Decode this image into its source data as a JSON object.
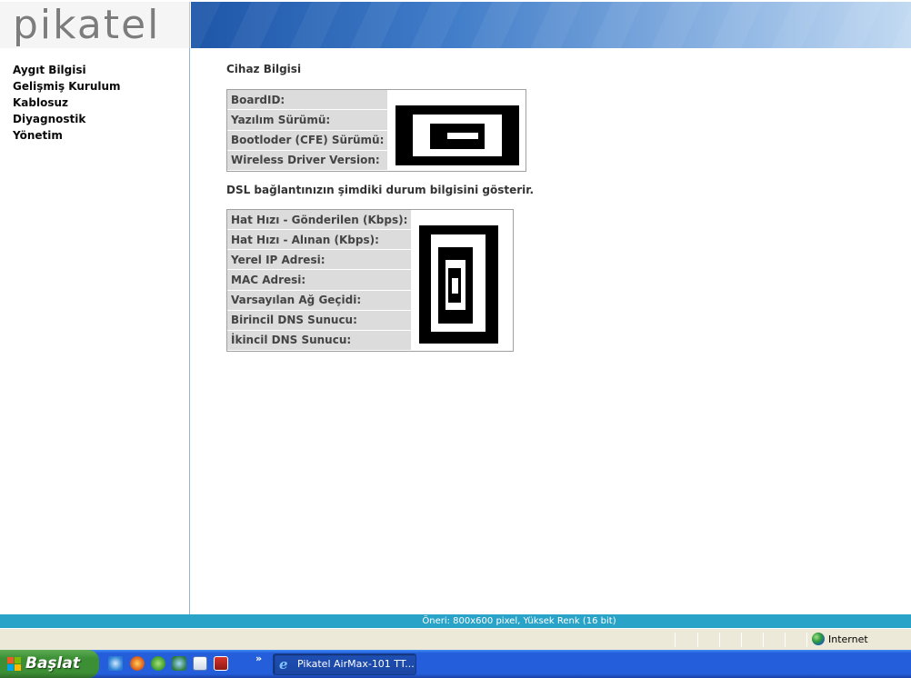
{
  "brand": {
    "logo_text": "pikatel"
  },
  "sidebar": {
    "items": [
      {
        "label": "Aygıt Bilgisi"
      },
      {
        "label": "Gelişmiş Kurulum"
      },
      {
        "label": "Kablosuz"
      },
      {
        "label": "Diyagnostik"
      },
      {
        "label": "Yönetim"
      }
    ]
  },
  "main": {
    "title": "Cihaz Bilgisi",
    "device_table": [
      {
        "label": "BoardID:"
      },
      {
        "label": "Yazılım Sürümü:"
      },
      {
        "label": "Bootloder (CFE) Sürümü:"
      },
      {
        "label": "Wireless Driver Version:"
      }
    ],
    "dsl_description": "DSL bağlantınızın şimdiki durum bilgisini gösterir.",
    "dsl_table": [
      {
        "label": "Hat Hızı - Gönderilen (Kbps):"
      },
      {
        "label": "Hat Hızı - Alınan (Kbps):"
      },
      {
        "label": "Yerel IP Adresi:"
      },
      {
        "label": "MAC Adresi:"
      },
      {
        "label": "Varsayılan Ağ Geçidi:"
      },
      {
        "label": "Birincil DNS Sunucu:"
      },
      {
        "label": "İkincil DNS Sunucu:"
      }
    ]
  },
  "hint_bar": {
    "text": "Öneri: 800x600 pixel, Yüksek Renk (16 bit)"
  },
  "ie_status": {
    "zone": "Internet"
  },
  "taskbar": {
    "start_label": "Başlat",
    "chevron": "»",
    "active_task": "Pikatel AirMax-101 TT...",
    "quick_launch_icons": [
      "ie-icon",
      "firefox-icon",
      "msn-icon",
      "messenger-icon",
      "outlook-icon",
      "media-icon"
    ]
  },
  "colors": {
    "hint_bar": "#2aa3c9",
    "taskbar": "#245edb",
    "start_button": "#3c8f34",
    "label_cell": "#dcdcdc"
  }
}
